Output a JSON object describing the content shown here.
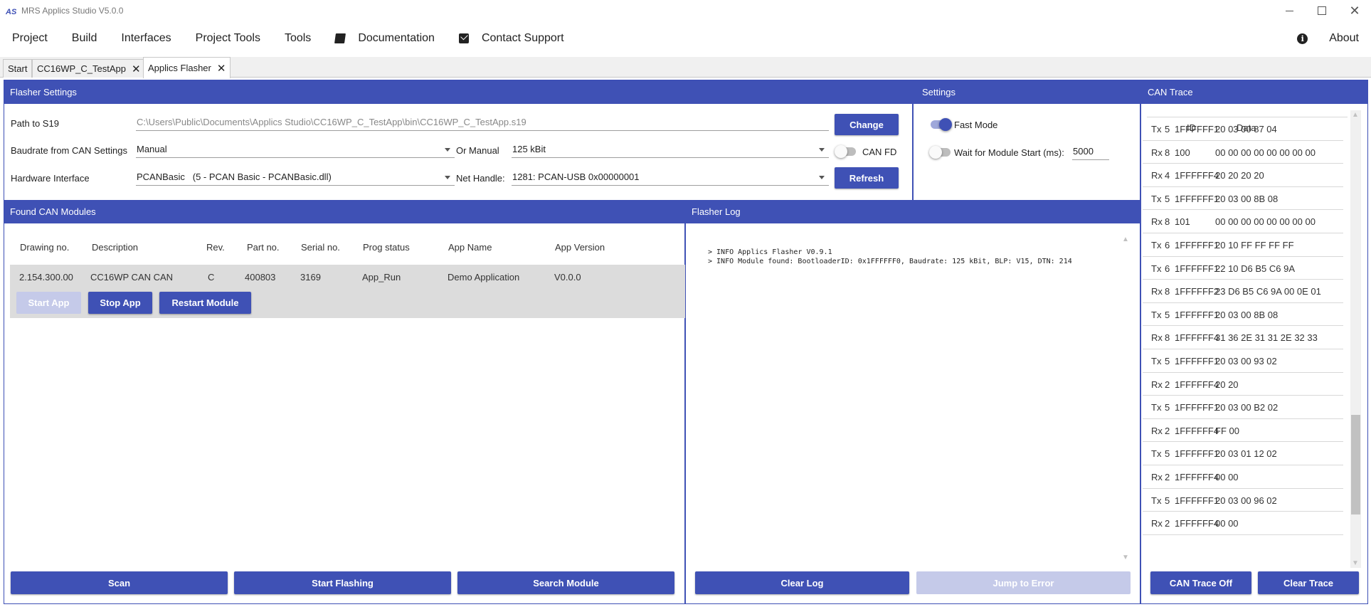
{
  "window": {
    "title": "MRS Applics Studio V5.0.0",
    "logo_text": "AS",
    "close_glyph": "✕"
  },
  "menu": {
    "items": [
      "Project",
      "Build",
      "Interfaces",
      "Project Tools",
      "Tools"
    ],
    "documentation": "Documentation",
    "contact_support": "Contact Support",
    "about": "About",
    "info_glyph": "i"
  },
  "tabs": [
    {
      "label": "Start",
      "closable": false
    },
    {
      "label": "CC16WP_C_TestApp",
      "closable": true
    },
    {
      "label": "Applics Flasher",
      "closable": true,
      "active": true
    }
  ],
  "tab_close_glyph": "✕",
  "flasher_settings": {
    "header": "Flasher Settings",
    "path_label": "Path to S19",
    "path_value": "C:\\Users\\Public\\Documents\\Applics Studio\\CC16WP_C_TestApp\\bin\\CC16WP_C_TestApp.s19",
    "change_button": "Change",
    "baudrate_label": "Baudrate from CAN Settings",
    "baudrate_value": "Manual",
    "or_manual_label": "Or Manual",
    "or_manual_value": "125 kBit",
    "canfd_label": "CAN FD",
    "canfd_on": false,
    "hw_label": "Hardware Interface",
    "hw_value": "PCANBasic   (5 - PCAN Basic - PCANBasic.dll)",
    "net_handle_label": "Net Handle:",
    "net_handle_value": "1281: PCAN-USB 0x00000001",
    "refresh_button": "Refresh"
  },
  "settings": {
    "header": "Settings",
    "fast_mode_label": "Fast Mode",
    "fast_mode_on": true,
    "wait_label": "Wait for Module Start (ms):",
    "wait_on": false,
    "wait_value": "5000"
  },
  "found_modules": {
    "header": "Found CAN Modules",
    "columns": [
      "Drawing no.",
      "Description",
      "Rev.",
      "Part no.",
      "Serial no.",
      "Prog status",
      "App Name",
      "App Version"
    ],
    "rows": [
      [
        "2.154.300.00",
        "CC16WP CAN CAN",
        "C",
        "400803",
        "3169",
        "App_Run",
        "Demo Application",
        "V0.0.0"
      ]
    ],
    "start_app": "Start App",
    "stop_app": "Stop App",
    "restart_module": "Restart Module",
    "scan": "Scan",
    "start_flashing": "Start Flashing",
    "search_module": "Search Module"
  },
  "flasher_log": {
    "header": "Flasher Log",
    "lines": [
      "> INFO Applics Flasher V0.9.1",
      "> INFO Module found: BootloaderID: 0x1FFFFFF0, Baudrate: 125 kBit, BLP: V15, DTN: 214"
    ],
    "clear_log": "Clear Log",
    "jump_to_error": "Jump to Error"
  },
  "can_trace": {
    "header": "CAN Trace",
    "col_id": "ID",
    "col_data": "Data",
    "rows": [
      [
        "Tx",
        "5",
        "1FFFFFF1",
        "20 03 00 87 04"
      ],
      [
        "Rx",
        "8",
        "100",
        "00 00 00 00 00 00 00 00"
      ],
      [
        "Rx",
        "4",
        "1FFFFFF4",
        "20 20 20 20"
      ],
      [
        "Tx",
        "5",
        "1FFFFFF1",
        "20 03 00 8B 08"
      ],
      [
        "Rx",
        "8",
        "101",
        "00 00 00 00 00 00 00 00"
      ],
      [
        "Tx",
        "6",
        "1FFFFFF1",
        "20 10 FF FF FF FF"
      ],
      [
        "Tx",
        "6",
        "1FFFFFF1",
        "22 10 D6 B5 C6 9A"
      ],
      [
        "Rx",
        "8",
        "1FFFFFF2",
        "23 D6 B5 C6 9A 00 0E 01"
      ],
      [
        "Tx",
        "5",
        "1FFFFFF1",
        "20 03 00 8B 08"
      ],
      [
        "Rx",
        "8",
        "1FFFFFF4",
        "31 36 2E 31 31 2E 32 33"
      ],
      [
        "Tx",
        "5",
        "1FFFFFF1",
        "20 03 00 93 02"
      ],
      [
        "Rx",
        "2",
        "1FFFFFF4",
        "20 20"
      ],
      [
        "Tx",
        "5",
        "1FFFFFF1",
        "20 03 00 B2 02"
      ],
      [
        "Rx",
        "2",
        "1FFFFFF4",
        "FF 00"
      ],
      [
        "Tx",
        "5",
        "1FFFFFF1",
        "20 03 01 12 02"
      ],
      [
        "Rx",
        "2",
        "1FFFFFF4",
        "00 00"
      ],
      [
        "Tx",
        "5",
        "1FFFFFF1",
        "20 03 00 96 02"
      ],
      [
        "Rx",
        "2",
        "1FFFFFF4",
        "00 00"
      ]
    ],
    "trace_off": "CAN Trace Off",
    "clear_trace": "Clear Trace"
  },
  "colors": {
    "accent": "#3f51b5",
    "accent_disabled": "#c5cae9",
    "row_selected": "#dcdcdc"
  },
  "glyphs": {
    "scroll_up": "▲",
    "scroll_down": "▼"
  }
}
